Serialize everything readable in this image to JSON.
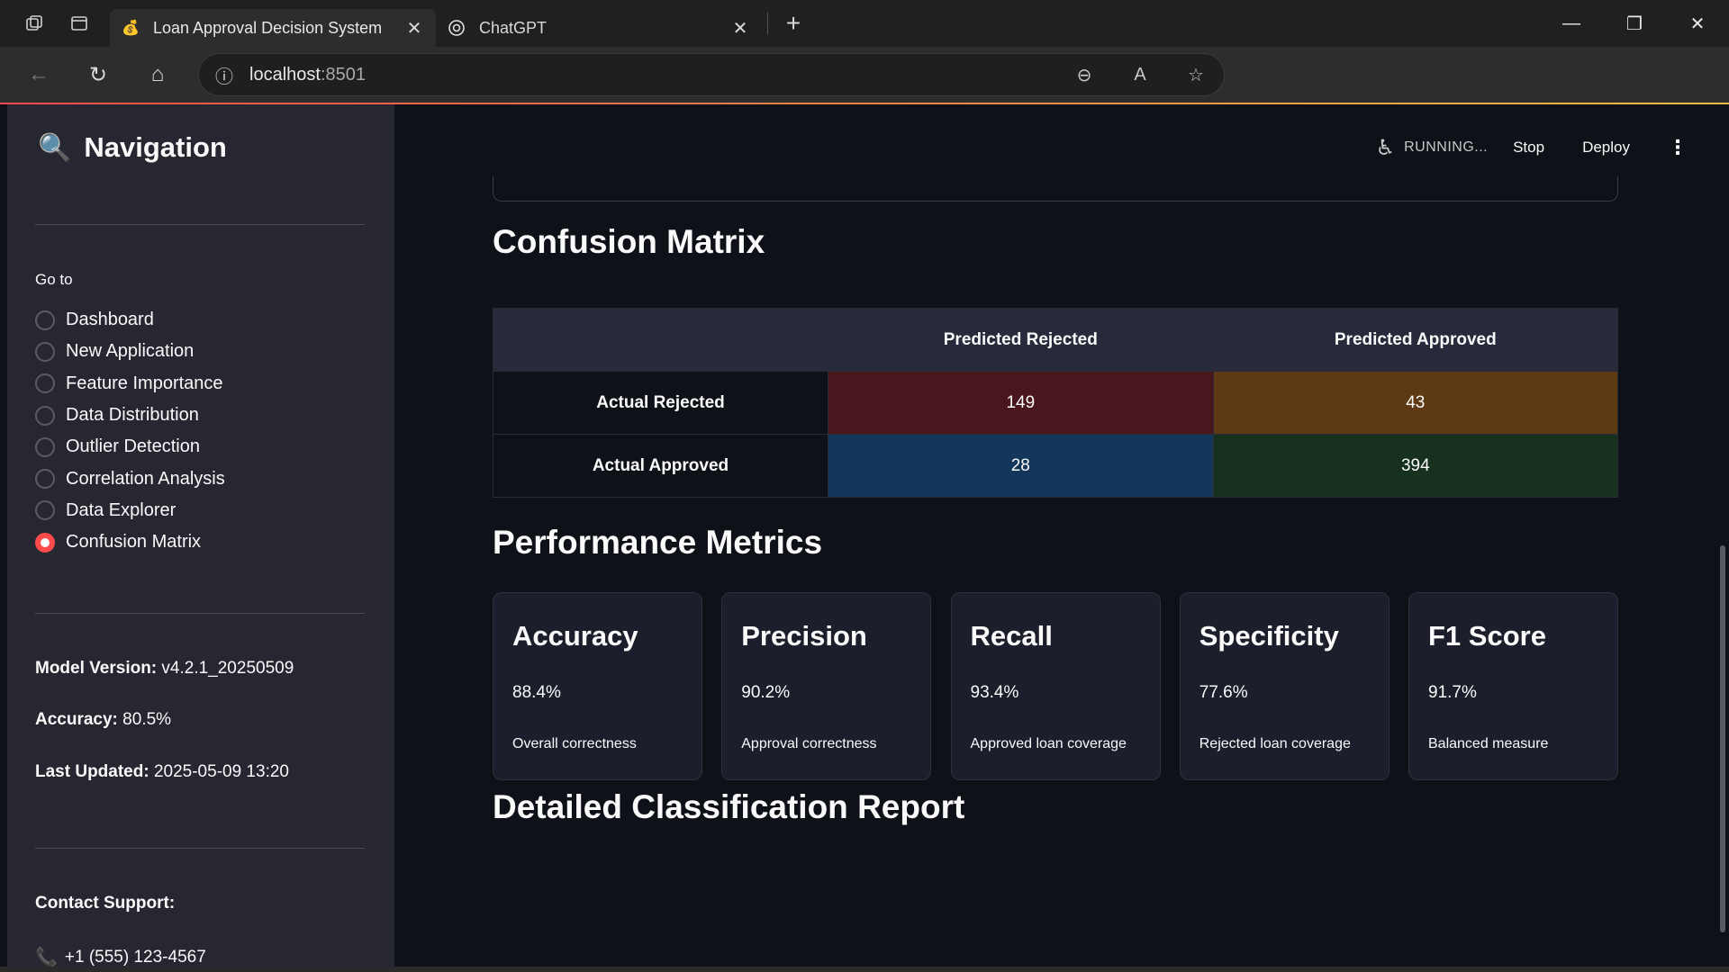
{
  "browser": {
    "tabs": [
      {
        "title": "Loan Approval Decision System",
        "icon": "money-bag-icon",
        "active": true
      },
      {
        "title": "ChatGPT",
        "icon": "chatgpt-icon",
        "active": false
      }
    ],
    "url_host": "localhost",
    "url_port": ":8501"
  },
  "sidebar": {
    "title": "Navigation",
    "title_icon": "magnifier-icon",
    "goto_label": "Go to",
    "items": [
      {
        "label": "Dashboard",
        "selected": false
      },
      {
        "label": "New Application",
        "selected": false
      },
      {
        "label": "Feature Importance",
        "selected": false
      },
      {
        "label": "Data Distribution",
        "selected": false
      },
      {
        "label": "Outlier Detection",
        "selected": false
      },
      {
        "label": "Correlation Analysis",
        "selected": false
      },
      {
        "label": "Data Explorer",
        "selected": false
      },
      {
        "label": "Confusion Matrix",
        "selected": true
      }
    ],
    "model_version_label": "Model Version:",
    "model_version": " v4.2.1_20250509",
    "accuracy_label": "Accuracy:",
    "accuracy": " 80.5%",
    "last_updated_label": "Last Updated:",
    "last_updated": " 2025-05-09 13:20",
    "contact_label": "Contact Support:",
    "phone": "+1 (555) 123-4567"
  },
  "header": {
    "status": "RUNNING...",
    "stop_label": "Stop",
    "deploy_label": "Deploy"
  },
  "main": {
    "confusion_title": "Confusion Matrix",
    "confusion": {
      "col_headers": [
        "Predicted Rejected",
        "Predicted Approved"
      ],
      "rows": [
        {
          "label": "Actual Rejected",
          "values": [
            "149",
            "43"
          ],
          "colors": [
            "#4a161d",
            "#5e3a14"
          ]
        },
        {
          "label": "Actual Approved",
          "values": [
            "28",
            "394"
          ],
          "colors": [
            "#14365a",
            "#17311f"
          ]
        }
      ]
    },
    "metrics_title": "Performance Metrics",
    "metrics": [
      {
        "title": "Accuracy",
        "value": "88.4%",
        "desc": "Overall correctness"
      },
      {
        "title": "Precision",
        "value": "90.2%",
        "desc": "Approval correctness"
      },
      {
        "title": "Recall",
        "value": "93.4%",
        "desc": "Approved loan coverage"
      },
      {
        "title": "Specificity",
        "value": "77.6%",
        "desc": "Rejected loan coverage"
      },
      {
        "title": "F1 Score",
        "value": "91.7%",
        "desc": "Balanced measure"
      }
    ],
    "report_title": "Detailed Classification Report"
  },
  "colors": {
    "accent": "#ff4b4b",
    "sidebar_bg": "#262730",
    "main_bg": "#0e1117"
  }
}
